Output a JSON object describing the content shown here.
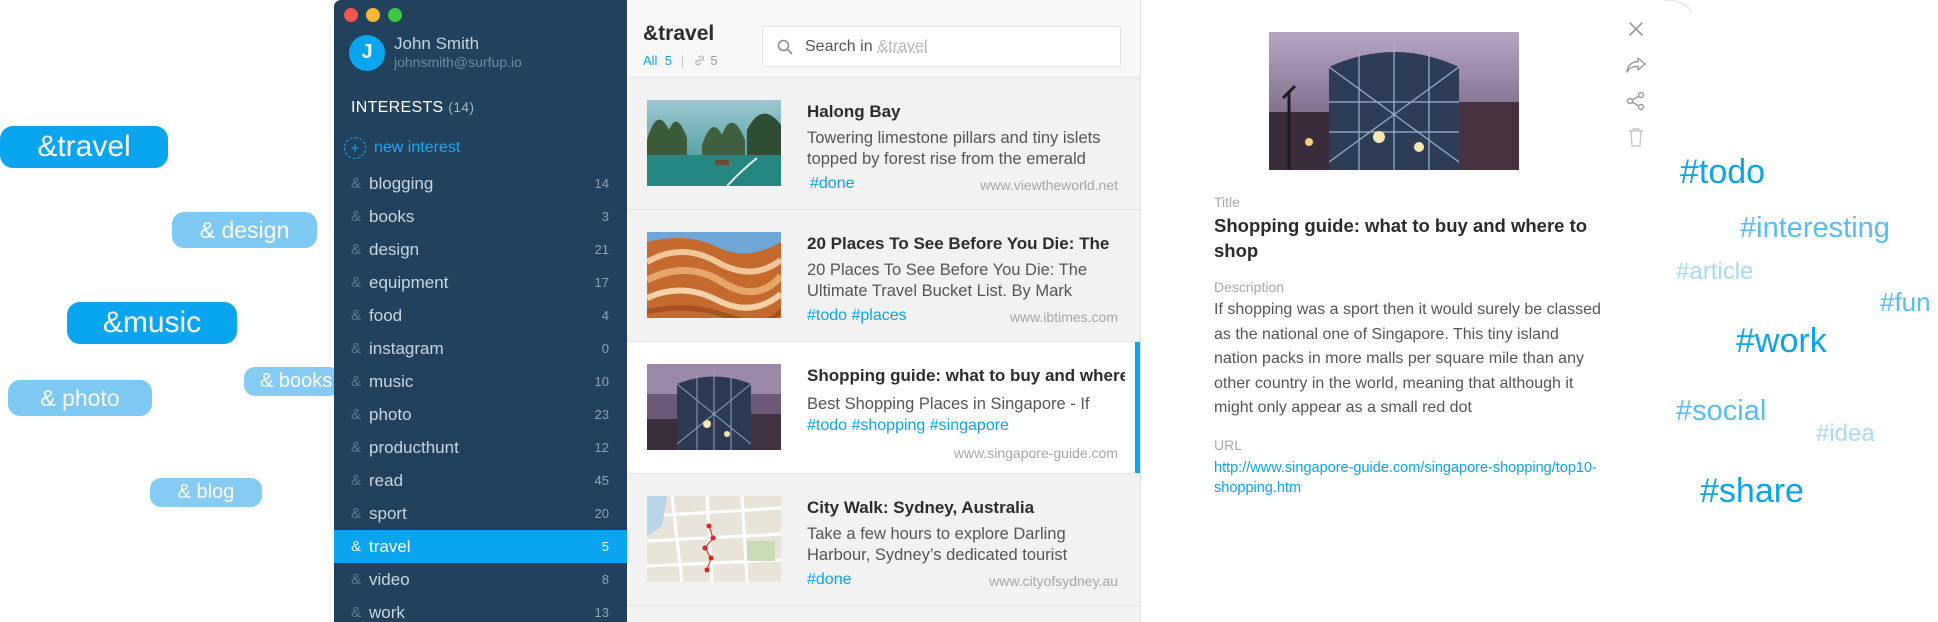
{
  "pills": {
    "travel": "&travel",
    "design": "& design",
    "music": "&music",
    "photo": "& photo",
    "books": "& books",
    "blog": "& blog"
  },
  "window": {
    "traffic_lights": [
      "close",
      "minimize",
      "maximize"
    ]
  },
  "user": {
    "avatar_initial": "J",
    "name": "John Smith",
    "email": "johnsmith@surfup.io"
  },
  "sidebar": {
    "heading": "INTERESTS",
    "heading_count": "(14)",
    "new_interest": "new interest",
    "amp_symbol": "&",
    "items": [
      {
        "label": "blogging",
        "count": "14"
      },
      {
        "label": "books",
        "count": "3"
      },
      {
        "label": "design",
        "count": "21"
      },
      {
        "label": "equipment",
        "count": "17"
      },
      {
        "label": "food",
        "count": "4"
      },
      {
        "label": "instagram",
        "count": "0"
      },
      {
        "label": "music",
        "count": "10"
      },
      {
        "label": "photo",
        "count": "23"
      },
      {
        "label": "producthunt",
        "count": "12"
      },
      {
        "label": "read",
        "count": "45"
      },
      {
        "label": "sport",
        "count": "20"
      },
      {
        "label": "travel",
        "count": "5",
        "active": true
      },
      {
        "label": "video",
        "count": "8"
      },
      {
        "label": "work",
        "count": "13"
      }
    ]
  },
  "list": {
    "title": "&travel",
    "filter_all": "All",
    "filter_all_count": "5",
    "filter_sep": "|",
    "filter_link_count": "5",
    "search_placeholder": "Search in",
    "search_scope": "&travel",
    "cards": [
      {
        "title": "Halong Bay",
        "desc": "Towering limestone pillars and tiny islets topped by forest rise from the emerald",
        "tags": "#done",
        "url": "www.viewtheworld.net"
      },
      {
        "title": "20 Places To See Before You Die: The",
        "desc": "20 Places To See Before You Die: The Ultimate Travel Bucket List. By Mark",
        "tags": "#todo #places",
        "url": "www.ibtimes.com"
      },
      {
        "title": "Shopping guide: what to buy and where",
        "desc": "Best Shopping Places in Singapore - If",
        "tags": "#todo #shopping #singapore",
        "url": "www.singapore-guide.com",
        "selected": true
      },
      {
        "title": "City Walk: Sydney, Australia",
        "desc": "Take a few hours to explore Darling Harbour, Sydney’s dedicated tourist",
        "tags": "#done",
        "url": "www.cityofsydney.au"
      }
    ]
  },
  "detail": {
    "title_label": "Title",
    "title": "Shopping guide: what to buy and where to shop",
    "description_label": "Description",
    "description": "If shopping was a sport then it would surely be classed as the national one of Singapore. This tiny island nation packs in more malls per square mile than any other country in the world, meaning that although it might only appear as a small red dot",
    "url_label": "URL",
    "url": "http://www.singapore-guide.com/singapore-shopping/top10-shopping.htm",
    "actions": [
      "close-icon",
      "forward-icon",
      "share-icon",
      "trash-icon"
    ]
  },
  "hashtags": {
    "todo": "#todo",
    "interesting": "#interesting",
    "article": "#article",
    "fun": "#fun",
    "work": "#work",
    "social": "#social",
    "idea": "#idea",
    "share": "#share"
  },
  "colors": {
    "accent": "#0aa5ee",
    "sidebar_bg": "#22415d",
    "pill_light": "#7ec9f3"
  }
}
